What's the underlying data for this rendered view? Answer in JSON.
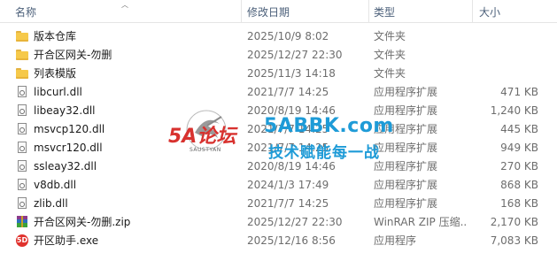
{
  "header": {
    "name": "名称",
    "date": "修改日期",
    "type": "类型",
    "size": "大小"
  },
  "files": [
    {
      "icon": "folder-icon",
      "name": "版本仓库",
      "date": "2025/10/9 8:02",
      "type": "文件夹",
      "size": ""
    },
    {
      "icon": "folder-icon",
      "name": "开合区网关-勿删",
      "date": "2025/12/27 22:30",
      "type": "文件夹",
      "size": ""
    },
    {
      "icon": "folder-icon",
      "name": "列表模版",
      "date": "2025/11/3 14:18",
      "type": "文件夹",
      "size": ""
    },
    {
      "icon": "dll-icon",
      "name": "libcurl.dll",
      "date": "2021/7/7 14:25",
      "type": "应用程序扩展",
      "size": "471 KB"
    },
    {
      "icon": "dll-icon",
      "name": "libeay32.dll",
      "date": "2020/8/19 14:46",
      "type": "应用程序扩展",
      "size": "1,240 KB"
    },
    {
      "icon": "dll-icon",
      "name": "msvcp120.dll",
      "date": "2021/7/7 14:25",
      "type": "应用程序扩展",
      "size": "445 KB"
    },
    {
      "icon": "dll-icon",
      "name": "msvcr120.dll",
      "date": "2021/7/7 14:25",
      "type": "应用程序扩展",
      "size": "949 KB"
    },
    {
      "icon": "dll-icon",
      "name": "ssleay32.dll",
      "date": "2020/8/19 14:46",
      "type": "应用程序扩展",
      "size": "270 KB"
    },
    {
      "icon": "dll-icon",
      "name": "v8db.dll",
      "date": "2024/1/3 17:49",
      "type": "应用程序扩展",
      "size": "868 KB"
    },
    {
      "icon": "dll-icon",
      "name": "zlib.dll",
      "date": "2021/7/7 14:25",
      "type": "应用程序扩展",
      "size": "168 KB"
    },
    {
      "icon": "winrar-zip-icon",
      "name": "开合区网关-勿删.zip",
      "date": "2025/12/27 22:30",
      "type": "WinRAR ZIP 压缩...",
      "size": "2,170 KB"
    },
    {
      "icon": "exe-app-icon",
      "name": "开区助手.exe",
      "date": "2025/12/16 8:56",
      "type": "应用程序",
      "size": "7,083 KB"
    }
  ],
  "watermark": {
    "logo_text": "5A论坛",
    "logo_sub": "SAUSTYAN",
    "domain": "5ABBK.com",
    "slogan": "技术赋能每一战"
  },
  "exe_icon_text": "5D"
}
